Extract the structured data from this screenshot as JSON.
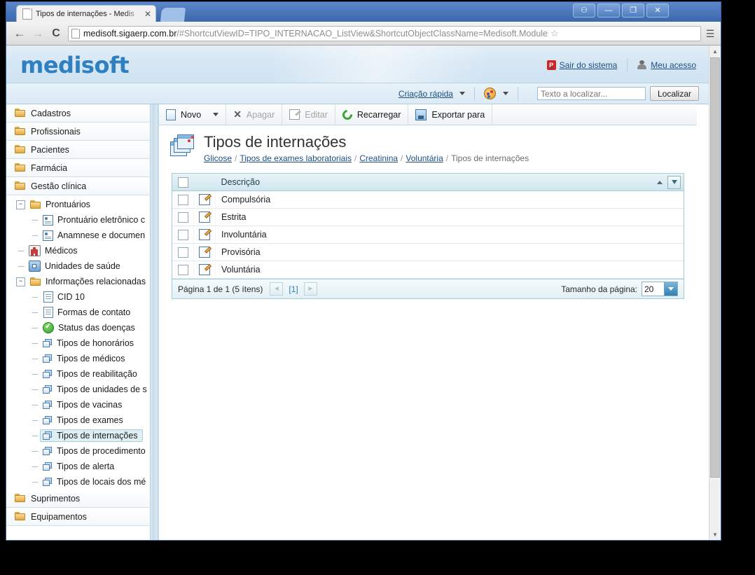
{
  "browser": {
    "tab_title": "Tipos de internações - Medis",
    "tab_close": "✕",
    "back_icon": "←",
    "forward_icon": "→",
    "reload_icon": "C",
    "url_strong": "medisoft.sigaerp.com.br",
    "url_dim": "/#ShortcutViewID=TIPO_INTERNACAO_ListView&ShortcutObjectClassName=Medisoft.Module",
    "star_icon": "☆",
    "menu_icon": "☰",
    "window_buttons": [
      "person",
      "minimize",
      "restore",
      "close"
    ],
    "window_glyphs": {
      "person": "⚇",
      "minimize": "—",
      "restore": "❐",
      "close": "✕"
    }
  },
  "app": {
    "logo": "medisoft",
    "header_links": [
      {
        "label": "Sair do sistema",
        "icon": "exit-icon"
      },
      {
        "label": "Meu acesso",
        "icon": "user-icon"
      }
    ],
    "subbar": {
      "quick_create": "Criação rápida",
      "theme_icon": "palette-icon",
      "search_placeholder": "Texto a localizar...",
      "search_value": "",
      "search_button": "Localizar"
    }
  },
  "sidebar": {
    "roots_top": [
      {
        "label": "Cadastros",
        "icon": "folder-icon"
      },
      {
        "label": "Profissionais",
        "icon": "folder-icon"
      },
      {
        "label": "Pacientes",
        "icon": "folder-icon"
      },
      {
        "label": "Farmácia",
        "icon": "folder-icon"
      },
      {
        "label": "Gestão clínica",
        "icon": "folder-icon"
      }
    ],
    "tree": [
      {
        "label": "Prontuários",
        "icon": "folder-icon",
        "level": 1,
        "expander": "−",
        "selected": false
      },
      {
        "label": "Prontuário eletrônico c",
        "icon": "card-icon",
        "level": 2,
        "expander": "",
        "selected": false
      },
      {
        "label": "Anamnese e documen",
        "icon": "card-icon",
        "level": 2,
        "expander": "",
        "selected": false
      },
      {
        "label": "Médicos",
        "icon": "doctor-icon",
        "level": 1,
        "expander": "",
        "selected": false
      },
      {
        "label": "Unidades de saúde",
        "icon": "home-icon",
        "level": 1,
        "expander": "",
        "selected": false
      },
      {
        "label": "Informações relacionadas",
        "icon": "folder-icon",
        "level": 1,
        "expander": "−",
        "selected": false
      },
      {
        "label": "CID 10",
        "icon": "doc-icon",
        "level": 2,
        "expander": "",
        "selected": false
      },
      {
        "label": "Formas de contato",
        "icon": "doc-icon",
        "level": 2,
        "expander": "",
        "selected": false
      },
      {
        "label": "Status das doenças",
        "icon": "check-icon",
        "level": 2,
        "expander": "",
        "selected": false
      },
      {
        "label": "Tipos de honorários",
        "icon": "stack-icon",
        "level": 2,
        "expander": "",
        "selected": false
      },
      {
        "label": "Tipos de médicos",
        "icon": "stack-icon",
        "level": 2,
        "expander": "",
        "selected": false
      },
      {
        "label": "Tipos de reabilitação",
        "icon": "stack-icon",
        "level": 2,
        "expander": "",
        "selected": false
      },
      {
        "label": "Tipos de unidades de s",
        "icon": "stack-icon",
        "level": 2,
        "expander": "",
        "selected": false
      },
      {
        "label": "Tipos de vacinas",
        "icon": "stack-icon",
        "level": 2,
        "expander": "",
        "selected": false
      },
      {
        "label": "Tipos de exames",
        "icon": "stack-icon",
        "level": 2,
        "expander": "",
        "selected": false
      },
      {
        "label": "Tipos de internações",
        "icon": "stack-icon",
        "level": 2,
        "expander": "",
        "selected": true
      },
      {
        "label": "Tipos de procedimento",
        "icon": "stack-icon",
        "level": 2,
        "expander": "",
        "selected": false
      },
      {
        "label": "Tipos de alerta",
        "icon": "stack-icon",
        "level": 2,
        "expander": "",
        "selected": false
      },
      {
        "label": "Tipos de locais dos mé",
        "icon": "stack-icon",
        "level": 2,
        "expander": "",
        "selected": false
      }
    ],
    "roots_bottom": [
      {
        "label": "Suprimentos",
        "icon": "folder-icon"
      },
      {
        "label": "Equipamentos",
        "icon": "folder-icon"
      }
    ]
  },
  "toolbar": {
    "new_label": "Novo",
    "delete_label": "Apagar",
    "edit_label": "Editar",
    "reload_label": "Recarregar",
    "export_label": "Exportar para"
  },
  "page": {
    "title": "Tipos de internações",
    "breadcrumb": [
      {
        "label": "Glicose",
        "link": true
      },
      {
        "label": "Tipos de exames laboratoriais",
        "link": true
      },
      {
        "label": "Creatinina",
        "link": true
      },
      {
        "label": "Voluntária",
        "link": true
      },
      {
        "label": "Tipos de internações",
        "link": false
      }
    ],
    "breadcrumb_sep": "/"
  },
  "grid": {
    "column_header": "Descrição",
    "sort_direction": "asc",
    "rows": [
      {
        "descricao": "Compulsória",
        "checked": false
      },
      {
        "descricao": "Estrita",
        "checked": false
      },
      {
        "descricao": "Involuntária",
        "checked": false
      },
      {
        "descricao": "Provisória",
        "checked": false
      },
      {
        "descricao": "Voluntária",
        "checked": false
      }
    ],
    "footer": {
      "page_info": "Página 1 de 1 (5 ítens)",
      "prev": "◄",
      "current_page": "[1]",
      "next": "►",
      "page_size_label": "Tamanho da página:",
      "page_size_value": "20"
    }
  },
  "colors": {
    "brand_blue": "#2f7fc1",
    "link_blue": "#1c4f80",
    "grid_header": "#cfe6ee",
    "selection": "#dff0f5"
  }
}
